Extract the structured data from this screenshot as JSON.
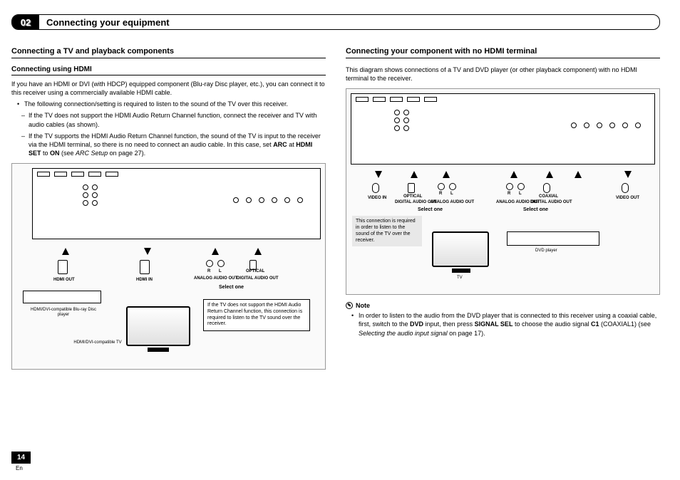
{
  "chapter": {
    "number": "02",
    "title": "Connecting your equipment"
  },
  "left": {
    "heading": "Connecting a TV and playback components",
    "sub1": "Connecting using HDMI",
    "intro": "If you have an HDMI or DVI (with HDCP) equipped component (Blu-ray Disc player, etc.), you can connect it to this receiver using a commercially available HDMI cable.",
    "bullet1": "The following connection/setting is required to listen to the sound of the TV over this receiver.",
    "dash1": "If the TV does not support the HDMI Audio Return Channel function, connect the receiver and TV with audio cables (as shown).",
    "dash2a": "If the TV supports the HDMI Audio Return Channel function, the sound of the TV is input to the receiver via the HDMI terminal, so there is no need to connect an audio cable. In this case, set ",
    "dash2_arc": "ARC",
    "dash2b": " at ",
    "dash2_hdmiset": "HDMI SET",
    "dash2c": " to ",
    "dash2_on": "ON",
    "dash2d": " (see ",
    "dash2_ref": "ARC Setup",
    "dash2e": " on page 27).",
    "diagram": {
      "hdmi_out": "HDMI OUT",
      "hdmi_in": "HDMI IN",
      "analog_audio_out": "ANALOG AUDIO OUT",
      "optical": "OPTICAL",
      "digital_audio_out": "DIGITAL AUDIO OUT",
      "select_one": "Select one",
      "bluray_caption": "HDMI/DVI-compatible Blu-ray Disc player",
      "tv_caption": "HDMI/DVI-compatible TV",
      "callout": "If the TV does not support the HDMI Audio Return Channel function, this connection is required to listen to the TV sound over the receiver.",
      "r": "R",
      "l": "L"
    }
  },
  "right": {
    "heading": "Connecting your component with no HDMI terminal",
    "intro": "This diagram shows connections of a TV and DVD player (or other playback component) with no HDMI terminal to the receiver.",
    "diagram": {
      "video_in": "VIDEO IN",
      "video_out": "VIDEO OUT",
      "optical": "OPTICAL",
      "coaxial": "COAXIAL",
      "analog_audio_out": "ANALOG AUDIO OUT",
      "digital_audio_out": "DIGITAL AUDIO OUT",
      "select_one": "Select one",
      "tv_caption": "TV",
      "dvd_caption": "DVD player",
      "callout_grey": "This connection is required in order to listen to the sound of the TV over the receiver.",
      "r": "R",
      "l": "L"
    },
    "note_label": "Note",
    "note1a": "In order to listen to the audio from the DVD player that is connected to this receiver using a coaxial cable, first, switch to the ",
    "note1_dvd": "DVD",
    "note1b": " input, then press ",
    "note1_sig": "SIGNAL SEL",
    "note1c": " to choose the audio signal ",
    "note1_c1": "C1",
    "note1d": " (COAXIAL1) (see ",
    "note1_ref": "Selecting the audio input signal",
    "note1e": " on page 17)."
  },
  "footer": {
    "page": "14",
    "lang": "En"
  }
}
